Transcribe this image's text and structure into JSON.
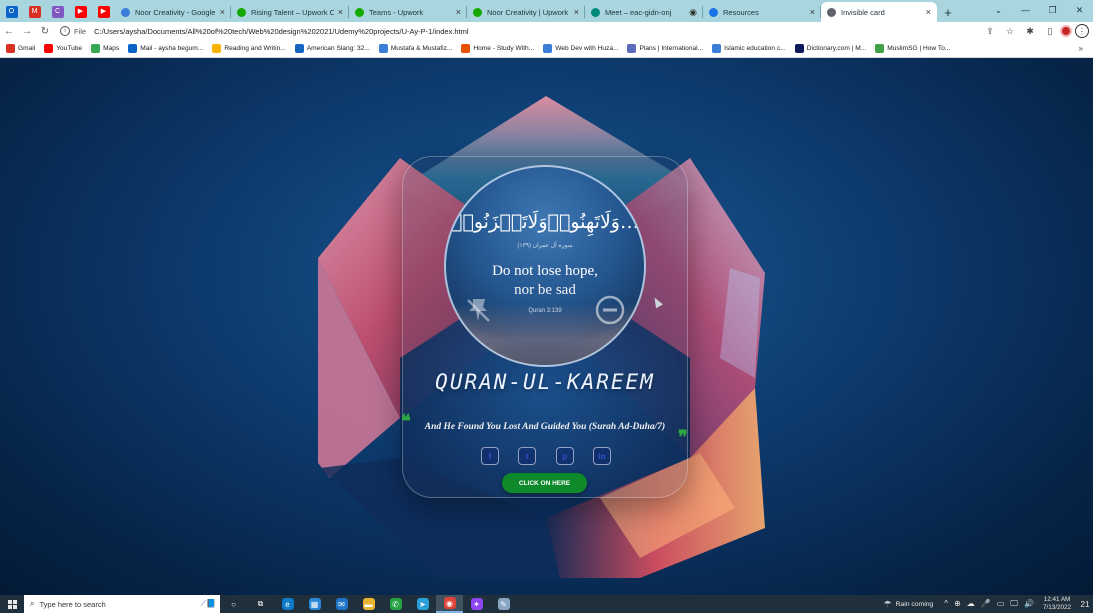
{
  "browser": {
    "pinned_tabs": [
      {
        "name": "outlook",
        "color": "#0a64c8",
        "glyph": "O"
      },
      {
        "name": "gmail",
        "color": "#d93025",
        "glyph": "M"
      },
      {
        "name": "chrome-extension",
        "color": "#7e57c2",
        "glyph": "C"
      },
      {
        "name": "youtube",
        "color": "#ff0000",
        "glyph": "▶"
      },
      {
        "name": "youtube",
        "color": "#ff0000",
        "glyph": "▶"
      }
    ],
    "tabs": [
      {
        "title": "Noor Creativity - Google D",
        "icon_color": "#3b7dd8",
        "close": "×",
        "active": false
      },
      {
        "title": "Rising Talent – Upwork Cc",
        "icon_color": "#14a800",
        "close": "×",
        "active": false
      },
      {
        "title": "Teams - Upwork",
        "icon_color": "#14a800",
        "close": "×",
        "active": false
      },
      {
        "title": "Noor Creativity | Upwork",
        "icon_color": "#14a800",
        "close": "×",
        "active": false
      },
      {
        "title": "Meet – eac-gidn-onj",
        "icon_color": "#00897b",
        "close": "◉",
        "active": false
      },
      {
        "title": "Resources",
        "icon_color": "#1a73e8",
        "close": "×",
        "active": false
      },
      {
        "title": "Invisible card",
        "icon_color": "#5f6368",
        "close": "×",
        "active": true
      }
    ],
    "new_tab": "+",
    "window_controls": {
      "dropdown": "⌄",
      "minimize": "—",
      "restore": "❐",
      "close": "✕"
    },
    "nav": {
      "back": "←",
      "forward": "→",
      "reload": "↻"
    },
    "address": {
      "info": "i",
      "scheme": "File",
      "url": "C:/Users/aysha/Documents/All%20of%20tech/Web%20design%202021/Udemy%20projects/U-Ay-P-1/index.html"
    },
    "toolbar_icons": {
      "share": "⇪",
      "star": "☆",
      "extensions": "✱",
      "sidebar": "▯",
      "menu": "⋮"
    },
    "bookmarks": [
      {
        "label": "Gmail",
        "color": "#d93025"
      },
      {
        "label": "YouTube",
        "color": "#ff0000"
      },
      {
        "label": "Maps",
        "color": "#34a853"
      },
      {
        "label": "Mail - aysha begum...",
        "color": "#0a64c8"
      },
      {
        "label": "Reading and Writin...",
        "color": "#f6b400"
      },
      {
        "label": "American Slang: 32...",
        "color": "#1565c0"
      },
      {
        "label": "Mustafa & Mustafiz...",
        "color": "#3b7dd8"
      },
      {
        "label": "Home - Study With...",
        "color": "#e65100"
      },
      {
        "label": "Web Dev with Huza...",
        "color": "#3b7dd8"
      },
      {
        "label": "Plans | International...",
        "color": "#5c6bc0"
      },
      {
        "label": "Islamic education c...",
        "color": "#3b7dd8"
      },
      {
        "label": "Dictionary.com | M...",
        "color": "#0d1b5e"
      },
      {
        "label": "MuslimSG | How To...",
        "color": "#43a047"
      }
    ],
    "bookmarks_more": "»"
  },
  "card": {
    "arabic_verse": "وَلَاتَهِنُوا۟وَلَاتَحۡزَنُوا۟…",
    "arabic_reference": "سورة آل عمران (١٣٩)",
    "line1": "Do not lose hope,",
    "line2": "nor be sad",
    "citation": "Quran 3:139",
    "title": "QURAN-UL-KAREEM",
    "quote_open": "❝",
    "quote_close": "❞",
    "verse": "And He Found You Lost And Guided You (Surah Ad-Duha/7)",
    "socials": [
      {
        "name": "facebook",
        "glyph": "f"
      },
      {
        "name": "twitter",
        "glyph": "t"
      },
      {
        "name": "pinterest",
        "glyph": "p"
      },
      {
        "name": "linkedin",
        "glyph": "in"
      }
    ],
    "button": "CLICK ON HERE",
    "colors": {
      "button": "#0f8a2a",
      "quote": "#2eaa42",
      "social_icon": "#2d52c8"
    }
  },
  "taskbar": {
    "search_placeholder": "Type here to search",
    "search_deco": "⟋📘",
    "apps": [
      {
        "name": "cortana",
        "glyph": "○",
        "color": "transparent"
      },
      {
        "name": "task-view",
        "glyph": "⧉",
        "color": "transparent"
      },
      {
        "name": "edge",
        "glyph": "e",
        "color": "#0f78c8"
      },
      {
        "name": "store",
        "glyph": "▦",
        "color": "#2a88d8"
      },
      {
        "name": "mail",
        "glyph": "✉",
        "color": "#1e74c6"
      },
      {
        "name": "file-explorer",
        "glyph": "▬",
        "color": "#e8b232"
      },
      {
        "name": "whatsapp",
        "glyph": "✆",
        "color": "#25a244"
      },
      {
        "name": "telegram",
        "glyph": "➤",
        "color": "#2a9fd8"
      },
      {
        "name": "chrome",
        "glyph": "◉",
        "color": "#db4437"
      },
      {
        "name": "messenger",
        "glyph": "✦",
        "color": "#8e44ef"
      },
      {
        "name": "notepad",
        "glyph": "✎",
        "color": "#88a6c4"
      }
    ],
    "weather": "Rain coming",
    "tray_icons": [
      "^",
      "⊕",
      "☁",
      "🎤",
      "▭",
      "🖵",
      "🔊"
    ],
    "time": "12:41 AM",
    "date": "7/13/2022",
    "notifications": "21"
  }
}
